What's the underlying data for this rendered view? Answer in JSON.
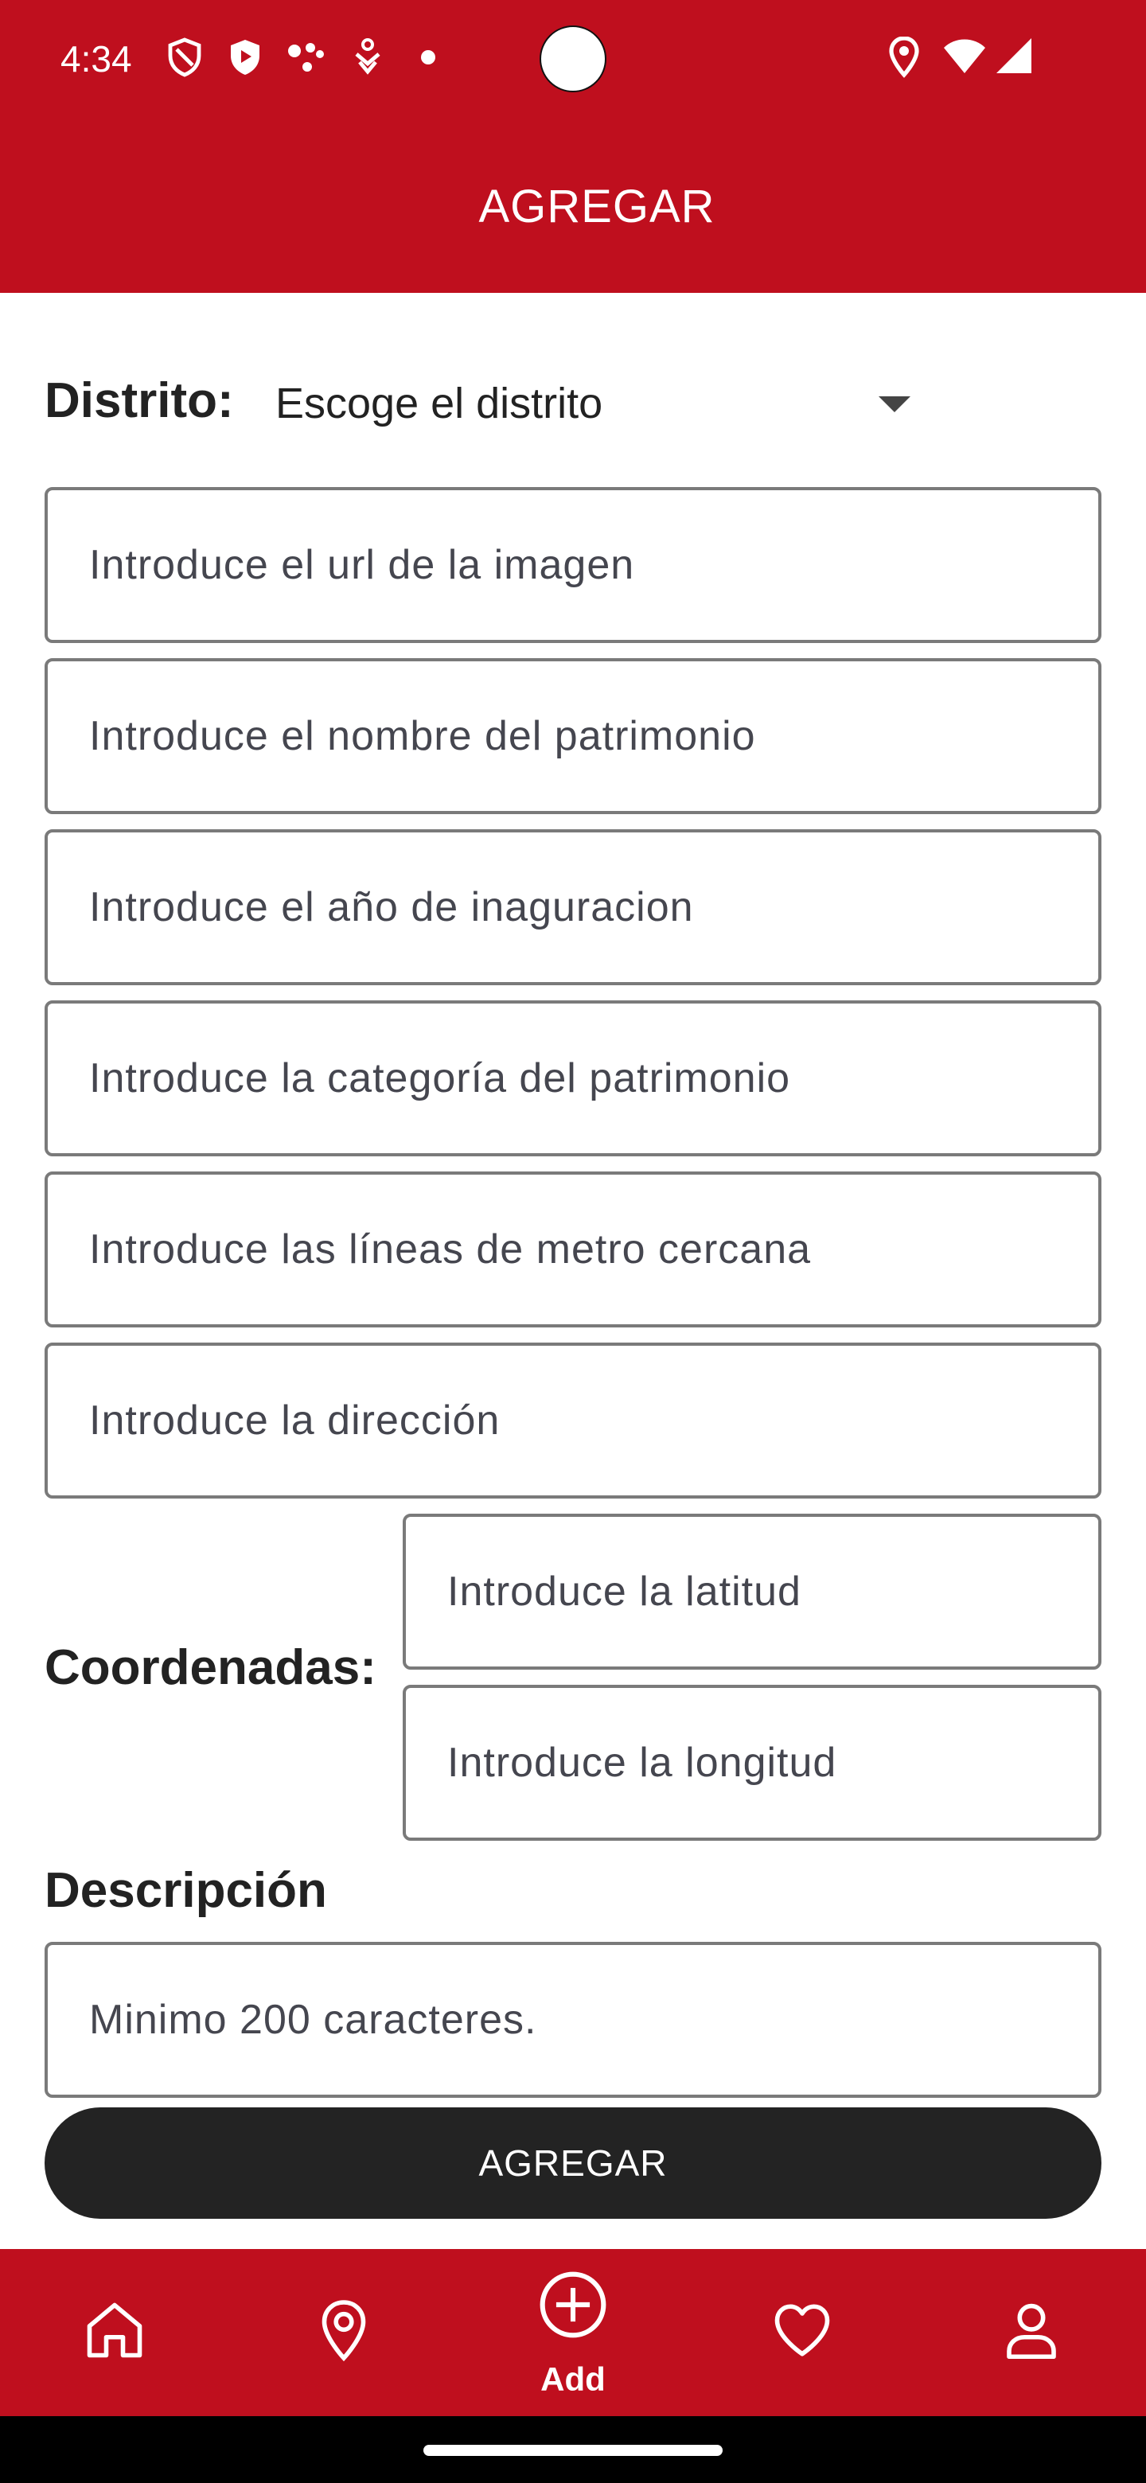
{
  "status_bar": {
    "time": "4:34",
    "icons": [
      "shield-outline-icon",
      "play-shield-icon",
      "dots-icon",
      "accessibility-icon",
      "dot-icon",
      "location-icon",
      "wifi-icon",
      "signal-icon"
    ]
  },
  "app_bar": {
    "title": "AGREGAR"
  },
  "form": {
    "district_label": "Distrito:",
    "district_value": "Escoge el distrito",
    "image_url_placeholder": "Introduce el url de la imagen",
    "name_placeholder": "Introduce el nombre del patrimonio",
    "year_placeholder": "Introduce el año de inaguracion",
    "category_placeholder": "Introduce la categoría del patrimonio",
    "metro_placeholder": "Introduce las líneas de metro cercana",
    "address_placeholder": "Introduce la dirección",
    "coords_label": "Coordenadas:",
    "latitude_placeholder": "Introduce la latitud",
    "longitude_placeholder": "Introduce la longitud",
    "description_label": "Descripción",
    "description_placeholder": "Minimo 200 caracteres.",
    "submit_label": "AGREGAR"
  },
  "bottom_nav": {
    "items": [
      {
        "icon": "home-icon",
        "label": ""
      },
      {
        "icon": "location-pin-icon",
        "label": ""
      },
      {
        "icon": "add-circle-icon",
        "label": "Add"
      },
      {
        "icon": "heart-icon",
        "label": ""
      },
      {
        "icon": "user-icon",
        "label": ""
      }
    ]
  },
  "colors": {
    "primary": "#bf0f1e",
    "button_dark": "#232323",
    "field_border": "#7a7a7a"
  }
}
